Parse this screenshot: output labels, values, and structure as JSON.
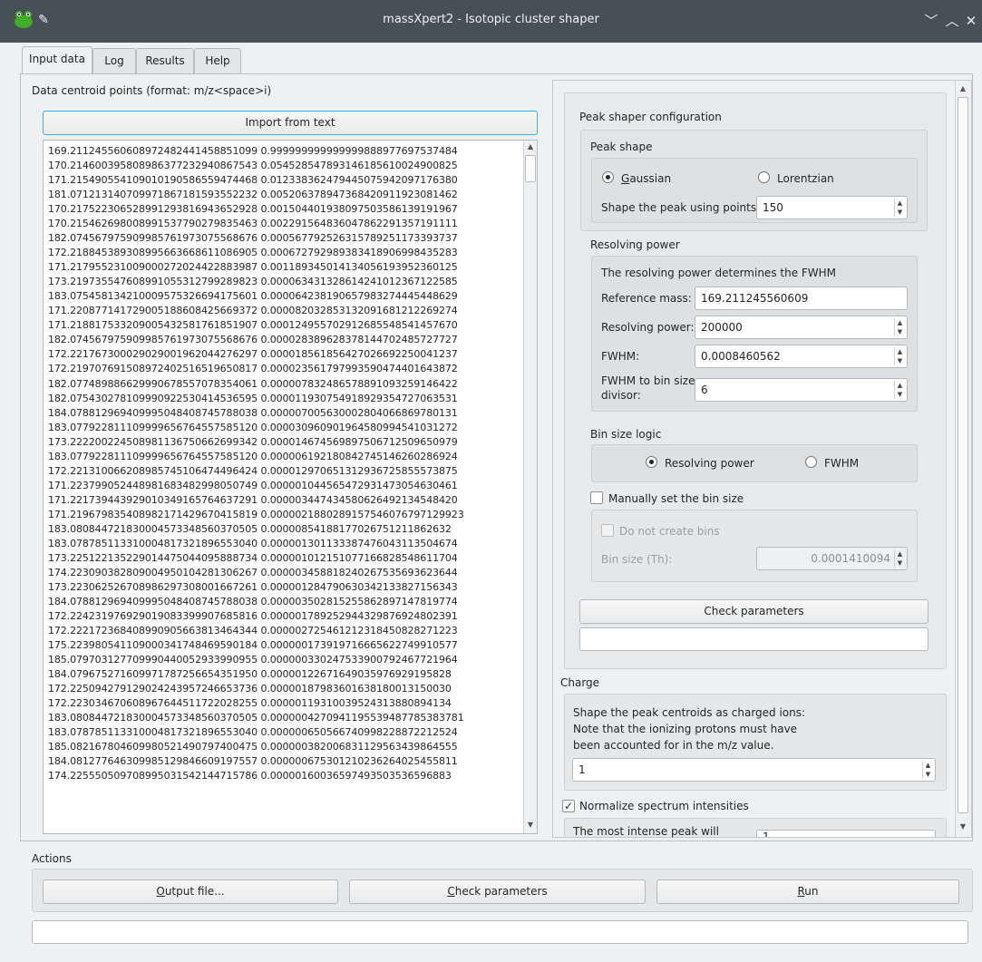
{
  "window": {
    "title": "massXpert2 - Isotopic cluster shaper",
    "app_icon": "app-icon",
    "pin_icon": "pin-icon",
    "controls": [
      "chevron-down-icon",
      "chevron-up-icon",
      "close-icon"
    ]
  },
  "tabs": [
    "Input data",
    "Log",
    "Results",
    "Help"
  ],
  "input": {
    "label": "Data centroid points (format: m/z<space>i)",
    "import_button": "Import from text",
    "lines": [
      "169.2112455606089724824414588510​99 0.99999999999999988897769753748​4",
      "170.21460039580898637723294086754​3 0.05452854789314618561002490082​5",
      "171.21549055410901019058655947446​8 0.01233836247944507594209717638​0",
      "181.07121314070997186718159355223​2 0.00520637894736842091192308146​2",
      "170.21752230652899129381694365292​8 0.00150440193809750358613919196​7",
      "170.21546269800899153779027983546​3 0.00229156483604786229135719111​1",
      "182.07456797590998576197307556867​6 0.00056779252631578925117339373​7",
      "172.21884538930899566366861108690​5 0.00067279298938341890699843528​3",
      "171.21795523100900027202442288398​7 0.00118934501413405619395236012​5",
      "173.21973554760899105531279928982​3 0.00006343132861424101236712258​5",
      "183.07545813421000957532669417560​1 0.00006423819065798327444544862​9",
      "171.22087714172900518860842566937​2 0.00008203285313209168121226927​4",
      "171.21881753320900543258176185190​7 0.00012495570291268554854145767​0",
      "182.07456797590998576197307556867​6 0.00002838962837814470248572772​7",
      "172.22176730002902900196204427629​7 0.00001856185642702669225004123​7",
      "172.21970769150897240251651965081​7 0.00002356179799359047440164387​2",
      "182.07748988662999067855707835406​1 0.00000783248657889109325914642​2",
      "182.07543027810999092253041453659​5 0.00001193075491892935472706353​1",
      "184.07881296940999504840874578803​8 0.00000700563000280406686978013​1",
      "183.07792281110999965676455758512​0 0.00003096090196458099454103127​2",
      "173.22220022450898113675066269934​2 0.00001467456989750671250965097​9",
      "183.07792281110999965676455758512​0 0.00000619218084274514626028692​4",
      "172.22131006620898574510647449642​4 0.00001297065131293672585557387​5",
      "171.22379905244898168348299805074​9 0.00000104456547293147305463046​1",
      "171.22173944392901034916576463729​1 0.00000344743458062649213454842​0",
      "171.21967983540898217142967041581​9 0.00000218802891575460767971299​23",
      "183.08084472183000457334856037050​5 0.00000854188177026751211862632",
      "183.07878511331000481732189655304​0 0.00000130113338747604311350467​4",
      "173.22512213522901447504409588873​4 0.00000101215107716682854861170​4",
      "174.22309038280900495010428130626​7 0.00000345881824026753569362364​4",
      "173.22306252670898629730800166726​1 0.00000128479063034213382715634​3",
      "184.07881296940999504840874578803​8 0.00000350281525586289714781977​4",
      "172.22423197692901908339990768581​6 0.00000178925294432987692480239​1",
      "172.22217236840899090566381346434​4 0.00000272546121231845082827122​3",
      "175.22398054110900034174846959018​4 0.00000017391971666562274991057​7",
      "185.07970312770999044005293399095​5 0.00000033024753390079246772196​4",
      "184.07967527160997178725665435195​0 0.00000122671649035976929195828",
      "172.22509427912902424395724665373​6 0.00000187983601638180013150030",
      "172.22303467060896764451172202825​5 0.00000119310039524313880894134",
      "183.08084472183000457334856037050​5 0.00000042709411955394877853837​81",
      "183.07878511331000481732189655304​0 0.00000065056674099822887221252​4",
      "185.08216780460998052149079740047​5 0.00000038200683112956343986455​5",
      "184.08127764630998512984660919755​7 0.00000067530121023626402545581​1",
      "174.22555050970899503154214471578​6 0.00000160036597493503536596883"
    ]
  },
  "peak_shaper": {
    "title": "Peak shaper configuration",
    "peak_shape": {
      "title": "Peak shape",
      "gaussian": "Gaussian",
      "lorentzian": "Lorentzian",
      "points_label": "Shape the peak using points:",
      "points_value": "150"
    },
    "resolving": {
      "title": "Resolving power",
      "desc": "The resolving power determines the FWHM",
      "ref_mass_label": "Reference mass:",
      "ref_mass_value": "169.211245560609",
      "rp_label": "Resolving power:",
      "rp_value": "200000",
      "fwhm_label": "FWHM:",
      "fwhm_value": "0.0008460562",
      "divisor_label_1": "FWHM to bin size",
      "divisor_label_2": "divisor:",
      "divisor_value": "6"
    },
    "bin_logic": {
      "title": "Bin size logic",
      "opt_rp": "Resolving power",
      "opt_fwhm": "FWHM"
    },
    "manual_bin": {
      "label": "Manually set the bin size",
      "no_bins": "Do not create bins",
      "bin_size_label": "Bin size (Th):",
      "bin_size_value": "0.0001410094"
    },
    "check_button": "Check parameters",
    "status": ""
  },
  "charge": {
    "title": "Charge",
    "desc_1": "Shape the peak centroids as charged ions:",
    "desc_2": "Note that the ionizing protons must have",
    "desc_3": "been accounted for in the m/z value.",
    "value": "1"
  },
  "normalize": {
    "label": "Normalize spectrum intensities",
    "desc": "The most intense peak will",
    "value": "1"
  },
  "actions": {
    "title": "Actions",
    "output": "Output file...",
    "check": "Check parameters",
    "run": "Run",
    "status": ""
  }
}
